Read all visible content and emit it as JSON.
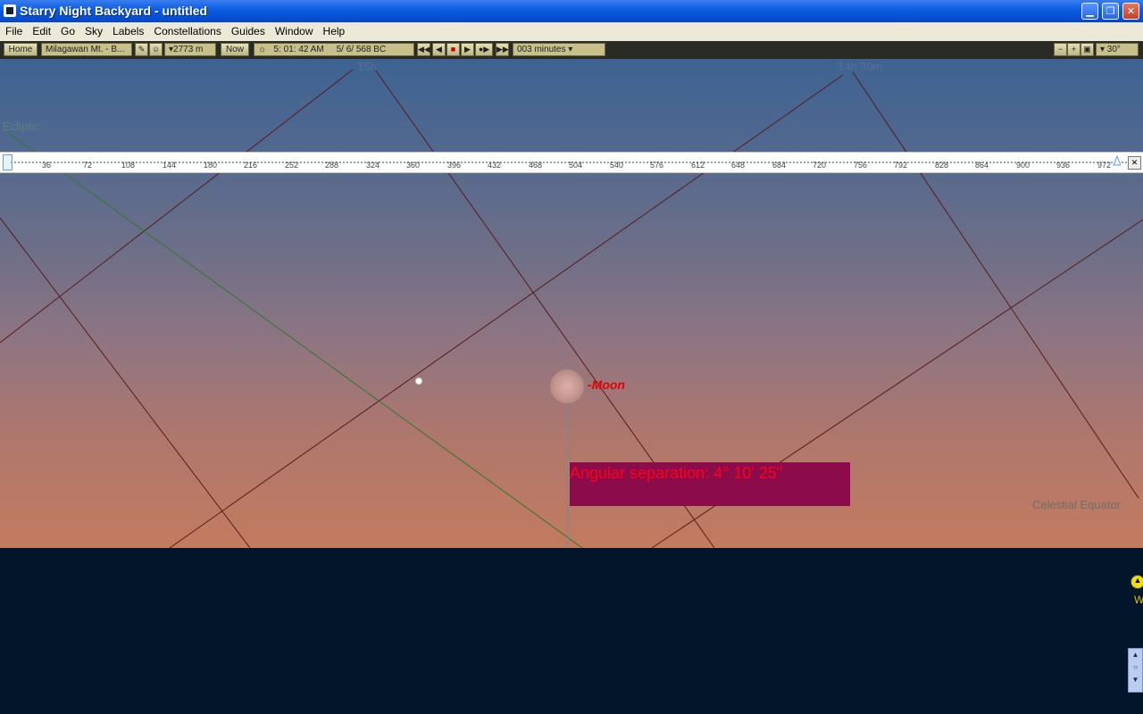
{
  "window": {
    "title": "Starry Night Backyard - untitled"
  },
  "menu": [
    "File",
    "Edit",
    "Go",
    "Sky",
    "Labels",
    "Constellations",
    "Guides",
    "Window",
    "Help"
  ],
  "toolbar": {
    "home": "Home",
    "location": "Milagawan Mt. - B...",
    "elevation": "▾2773 m",
    "now": "Now",
    "time": "5: 01: 42 AM",
    "date": "5/  6/  568 BC",
    "step": "003 minutes ▾",
    "fov": "▾ 30°"
  },
  "sky": {
    "ra_labels": [
      "15h",
      "14h 30m"
    ],
    "ecliptic": "Ecliptic",
    "equator": "Celestial Equator",
    "moon": "-Moon",
    "separation": "Angular separation: 4° 10' 25\""
  },
  "ruler": {
    "ticks": [
      "36",
      "72",
      "108",
      "144",
      "180",
      "216",
      "252",
      "288",
      "324",
      "360",
      "396",
      "432",
      "468",
      "504",
      "540",
      "576",
      "612",
      "648",
      "684",
      "720",
      "756",
      "792",
      "828",
      "864",
      "900",
      "936",
      "972"
    ]
  },
  "widgets": {
    "west": "W"
  }
}
